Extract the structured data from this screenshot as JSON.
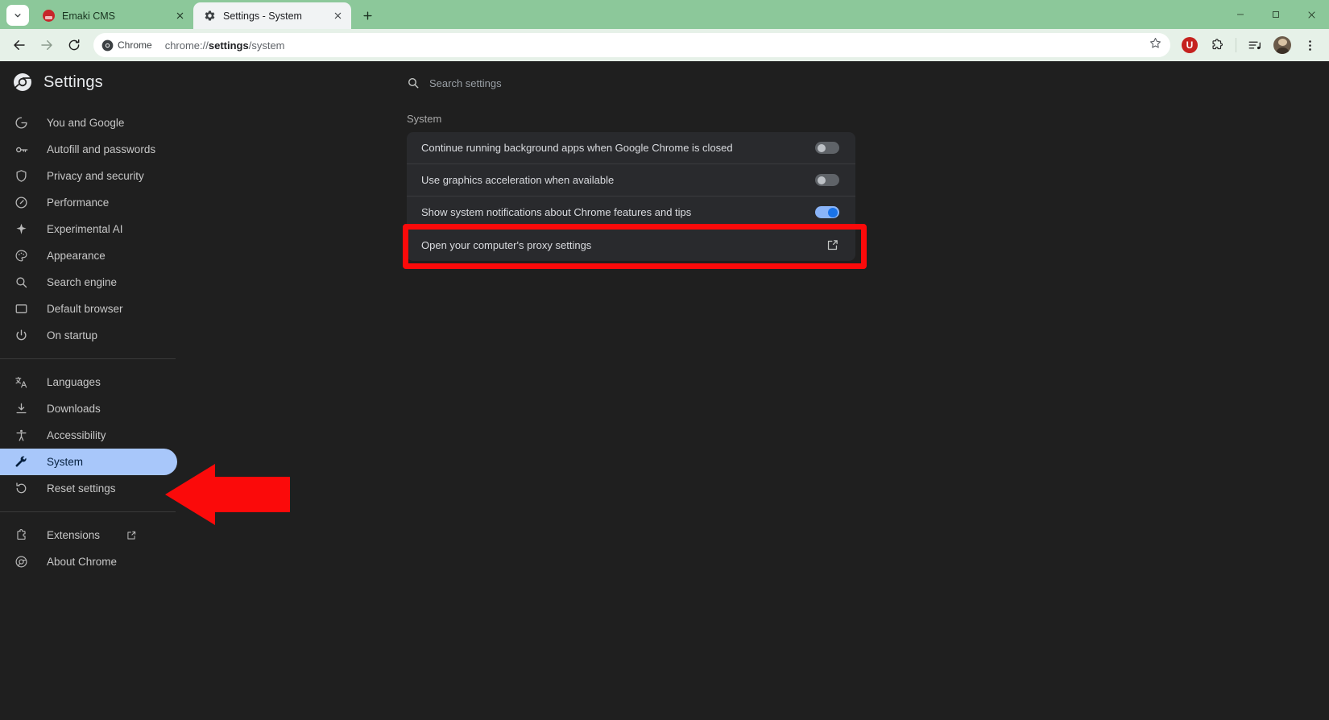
{
  "window": {
    "controls": {
      "minimize": "–",
      "maximize": "❐",
      "close": "✕"
    },
    "tab_search_icon": "chevron-down-icon"
  },
  "tabs": [
    {
      "title": "Emaki CMS",
      "active": false,
      "favicon": "emaki-favicon",
      "close_label": "✕"
    },
    {
      "title": "Settings - System",
      "active": true,
      "favicon": "gear-icon",
      "close_label": "✕"
    }
  ],
  "new_tab_label": "+",
  "toolbar": {
    "back_icon": "back-arrow-icon",
    "forward_icon": "forward-arrow-icon",
    "reload_icon": "reload-icon",
    "chip_label": "Chrome",
    "url_prefix": "chrome://",
    "url_bold": "settings",
    "url_suffix": "/system",
    "url_full": "chrome://settings/system",
    "bookmark_icon": "star-icon",
    "extension_badge_letter": "U",
    "extensions_icon": "puzzle-piece-icon",
    "media_icon": "media-list-icon",
    "profile_icon": "avatar",
    "menu_icon": "three-dot-menu-icon"
  },
  "sidebar": {
    "brand": "Settings",
    "brand_icon": "chrome-logo-icon",
    "items": [
      {
        "label": "You and Google",
        "icon": "google-g-icon",
        "selected": false
      },
      {
        "label": "Autofill and passwords",
        "icon": "key-icon",
        "selected": false
      },
      {
        "label": "Privacy and security",
        "icon": "shield-icon",
        "selected": false
      },
      {
        "label": "Performance",
        "icon": "speedometer-icon",
        "selected": false
      },
      {
        "label": "Experimental AI",
        "icon": "sparkle-icon",
        "selected": false
      },
      {
        "label": "Appearance",
        "icon": "palette-icon",
        "selected": false
      },
      {
        "label": "Search engine",
        "icon": "search-icon",
        "selected": false
      },
      {
        "label": "Default browser",
        "icon": "window-icon",
        "selected": false
      },
      {
        "label": "On startup",
        "icon": "power-icon",
        "selected": false
      }
    ],
    "items2": [
      {
        "label": "Languages",
        "icon": "translate-icon",
        "selected": false
      },
      {
        "label": "Downloads",
        "icon": "download-icon",
        "selected": false
      },
      {
        "label": "Accessibility",
        "icon": "accessibility-icon",
        "selected": false
      },
      {
        "label": "System",
        "icon": "wrench-icon",
        "selected": true
      },
      {
        "label": "Reset settings",
        "icon": "restore-icon",
        "selected": false
      }
    ],
    "items3": [
      {
        "label": "Extensions",
        "icon": "extension-icon",
        "external": true,
        "selected": false
      },
      {
        "label": "About Chrome",
        "icon": "chrome-outline-icon",
        "external": false,
        "selected": false
      }
    ]
  },
  "main": {
    "search_placeholder": "Search settings",
    "search_icon": "search-icon",
    "section_title": "System",
    "rows": [
      {
        "label": "Continue running background apps when Google Chrome is closed",
        "control": "toggle",
        "state": "off"
      },
      {
        "label": "Use graphics acceleration when available",
        "control": "toggle",
        "state": "off"
      },
      {
        "label": "Show system notifications about Chrome features and tips",
        "control": "toggle",
        "state": "on"
      },
      {
        "label": "Open your computer's proxy settings",
        "control": "external-link",
        "state": ""
      }
    ]
  },
  "annotations": {
    "highlight_color": "#fb0a0a",
    "highlight_target": "Use graphics acceleration when available",
    "arrow_color": "#fb0a0a",
    "arrow_target": "System"
  },
  "colors": {
    "tabstrip": "#8cc89a",
    "toolbar": "#e6f1e8",
    "page_bg": "#1f1f1f",
    "card_bg": "#292a2d",
    "selected_nav": "#a8c7fa",
    "toggle_on": "#8ab4f8",
    "annotation": "#fb0a0a"
  }
}
